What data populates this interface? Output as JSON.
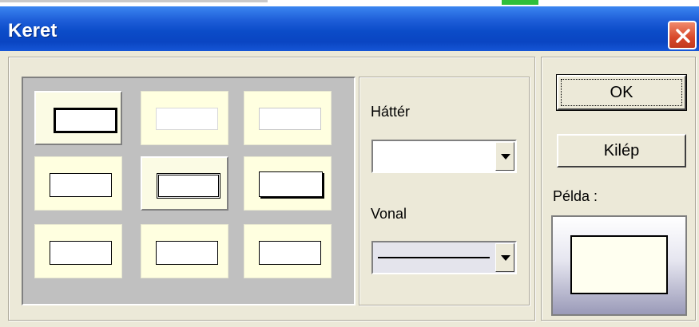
{
  "window": {
    "title": "Keret"
  },
  "frame_styles": {
    "items": [
      {
        "style": "thick-black",
        "selected": true
      },
      {
        "style": "thin-light",
        "selected": false
      },
      {
        "style": "thin-light",
        "selected": false
      },
      {
        "style": "thin-black",
        "selected": false
      },
      {
        "style": "double-black",
        "selected": true
      },
      {
        "style": "shadow-black",
        "selected": false
      },
      {
        "style": "thin-black",
        "selected": false
      },
      {
        "style": "thin-black",
        "selected": false
      },
      {
        "style": "thin-black",
        "selected": false
      }
    ]
  },
  "background": {
    "label": "Háttér",
    "value": ""
  },
  "line": {
    "label": "Vonal",
    "value": "solid-line"
  },
  "buttons": {
    "ok": "OK",
    "exit": "Kilép"
  },
  "preview": {
    "label": "Példa :"
  },
  "colors": {
    "title_bar": "#0a45c2",
    "close_button": "#d8482a",
    "cell_background": "#ffffe0"
  }
}
